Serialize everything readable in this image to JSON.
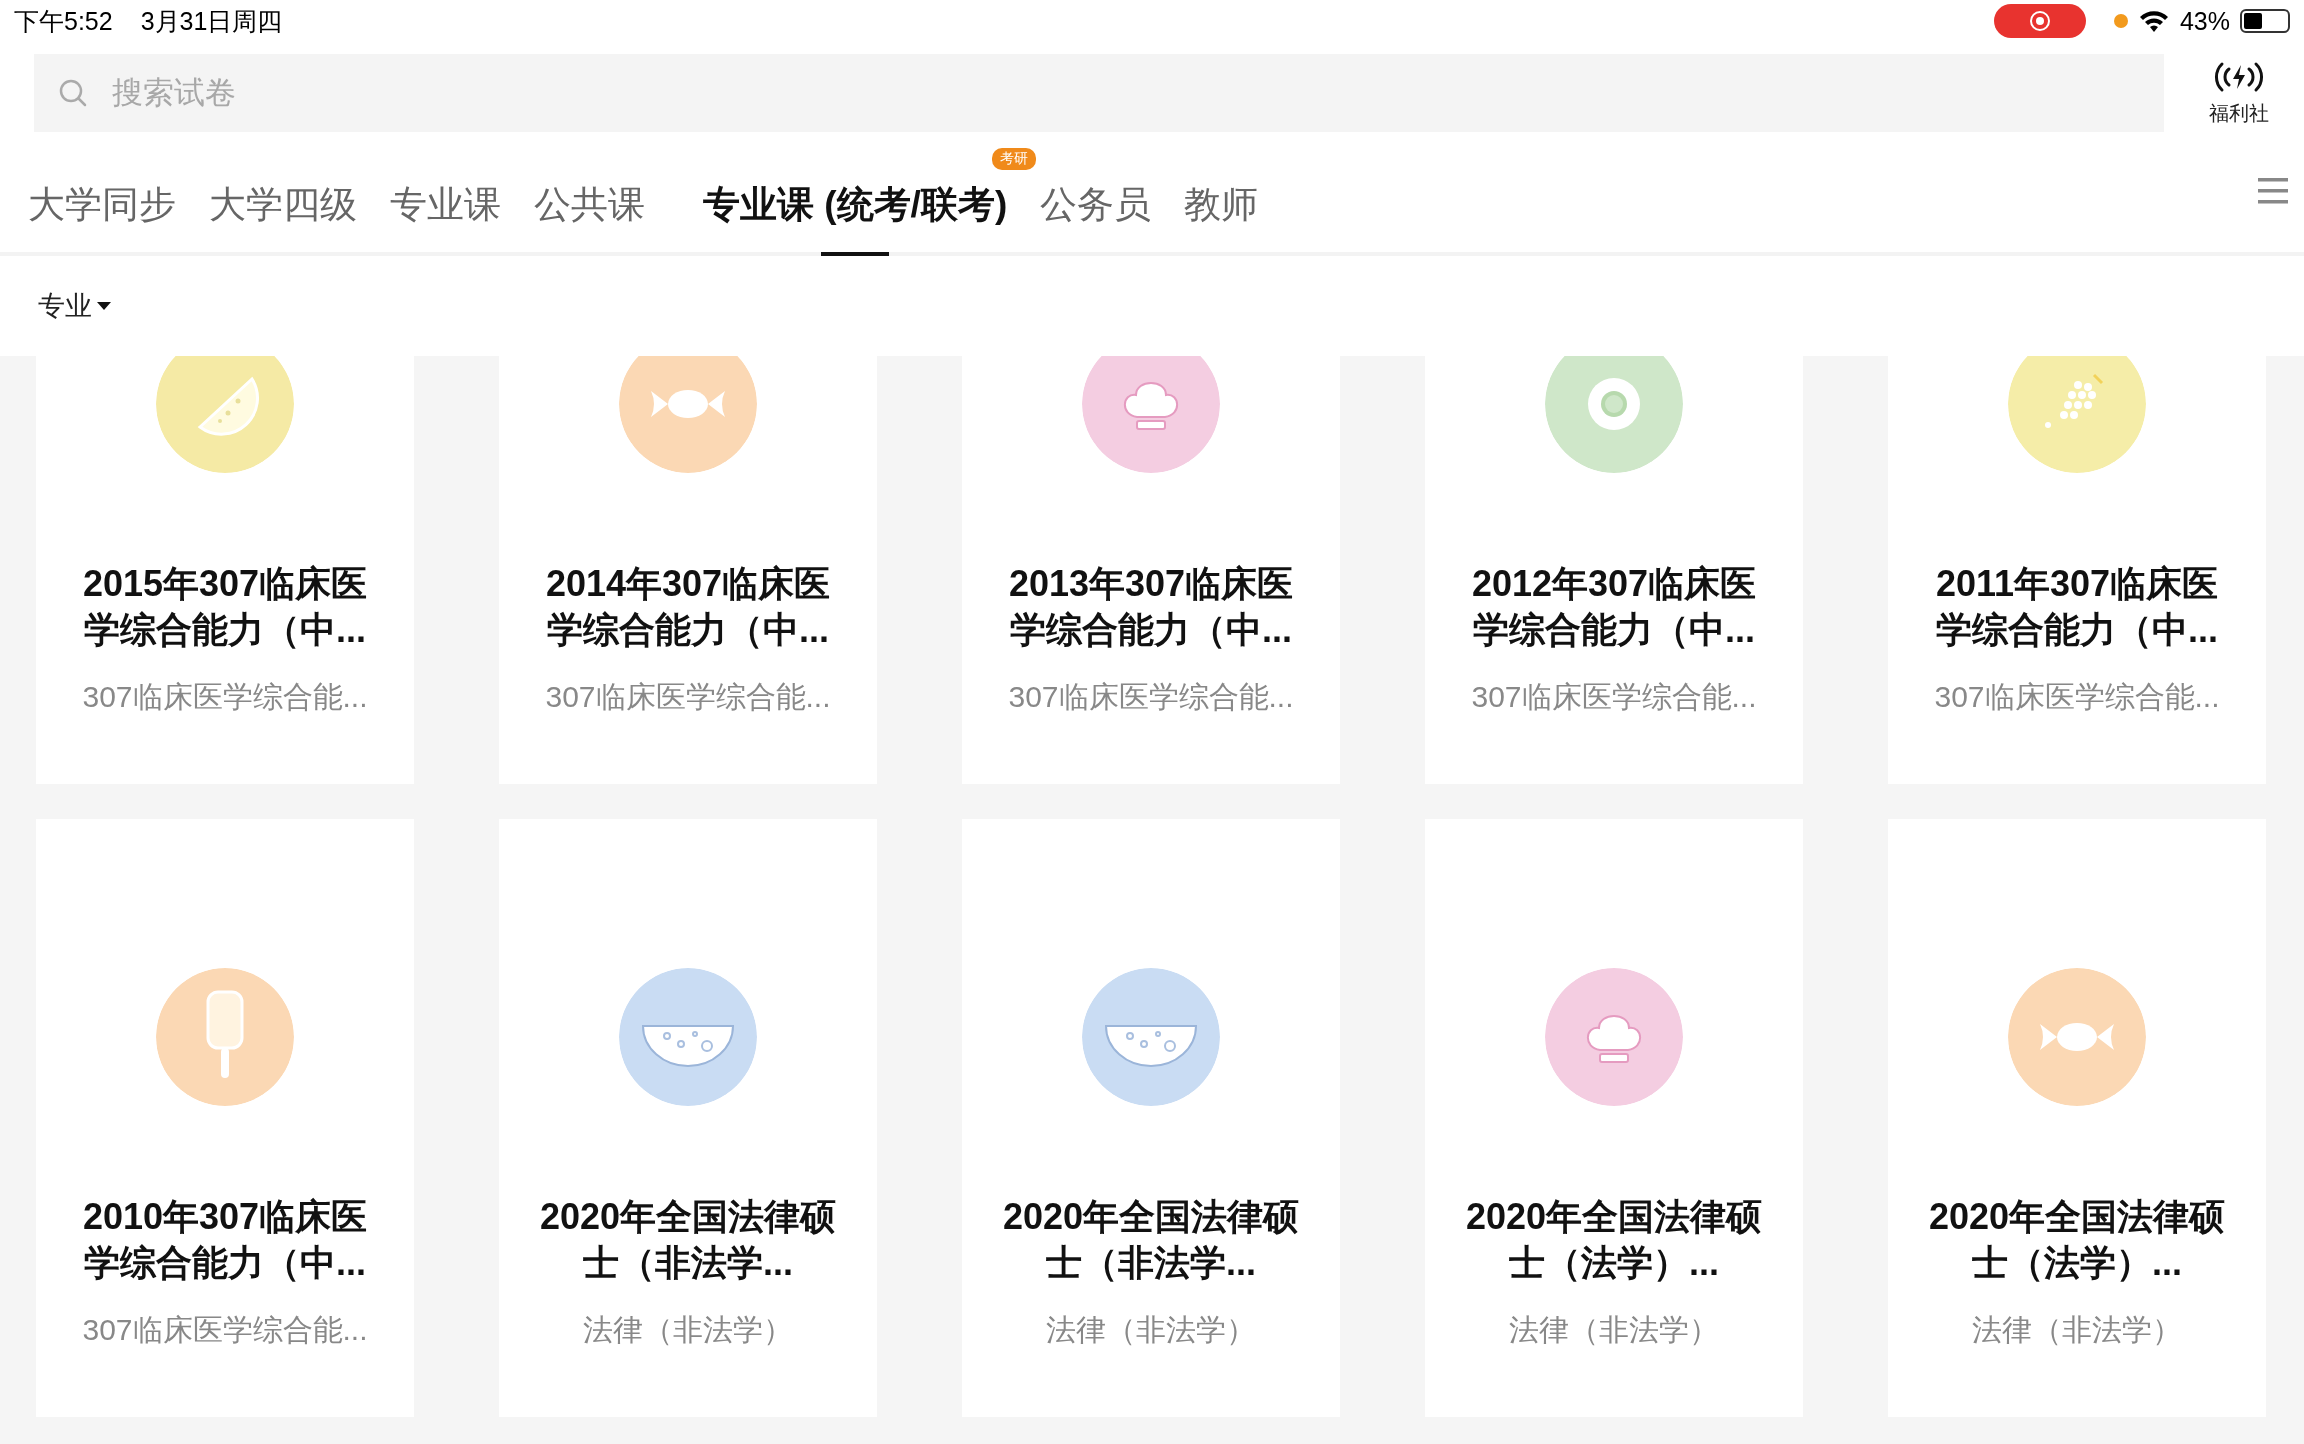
{
  "status_bar": {
    "time": "下午5:52",
    "date": "3月31日周四",
    "recording": true,
    "battery_text": "43%",
    "battery": {
      "level": 0.43
    }
  },
  "search": {
    "placeholder": "搜索试卷"
  },
  "welfare": {
    "label": "福利社"
  },
  "tabs": [
    {
      "label": "大学同步",
      "selected": false
    },
    {
      "label": "大学四级",
      "selected": false
    },
    {
      "label": "专业课",
      "selected": false
    },
    {
      "label": "公共课",
      "selected": false
    },
    {
      "label": "专业课 (统考/联考)",
      "selected": true,
      "badge": "考研"
    },
    {
      "label": "公务员",
      "selected": false
    },
    {
      "label": "教师",
      "selected": false
    }
  ],
  "filter": {
    "label": "专业"
  },
  "papers": [
    {
      "title": "2015年307临床医学综合能力（中...",
      "subtitle": "307临床医学综合能...",
      "kind": "melon",
      "color": "#f5eaa5"
    },
    {
      "title": "2014年307临床医学综合能力（中...",
      "subtitle": "307临床医学综合能...",
      "kind": "candy",
      "color": "#fbd8b4"
    },
    {
      "title": "2013年307临床医学综合能力（中...",
      "subtitle": "307临床医学综合能...",
      "kind": "chef-hat",
      "color": "#f4cde1"
    },
    {
      "title": "2012年307临床医学综合能力（中...",
      "subtitle": "307临床医学综合能...",
      "kind": "donut",
      "color": "#cfe7c9"
    },
    {
      "title": "2011年307临床医学综合能力（中...",
      "subtitle": "307临床医学综合能...",
      "kind": "grapes",
      "color": "#f5eda8"
    },
    {
      "title": "2010年307临床医学综合能力（中...",
      "subtitle": "307临床医学综合能...",
      "kind": "popsicle",
      "color": "#fbd8b4"
    },
    {
      "title": "2020年全国法律硕士（非法学...",
      "subtitle": "法律（非法学）",
      "kind": "bowl",
      "color": "#c9dcf3"
    },
    {
      "title": "2020年全国法律硕士（非法学...",
      "subtitle": "法律（非法学）",
      "kind": "bowl",
      "color": "#c9dcf3"
    },
    {
      "title": "2020年全国法律硕士（法学）...",
      "subtitle": "法律（非法学）",
      "kind": "chef-hat",
      "color": "#f4cde1"
    },
    {
      "title": "2020年全国法律硕士（法学）...",
      "subtitle": "法律（非法学）",
      "kind": "candy",
      "color": "#fbd8b4"
    }
  ]
}
